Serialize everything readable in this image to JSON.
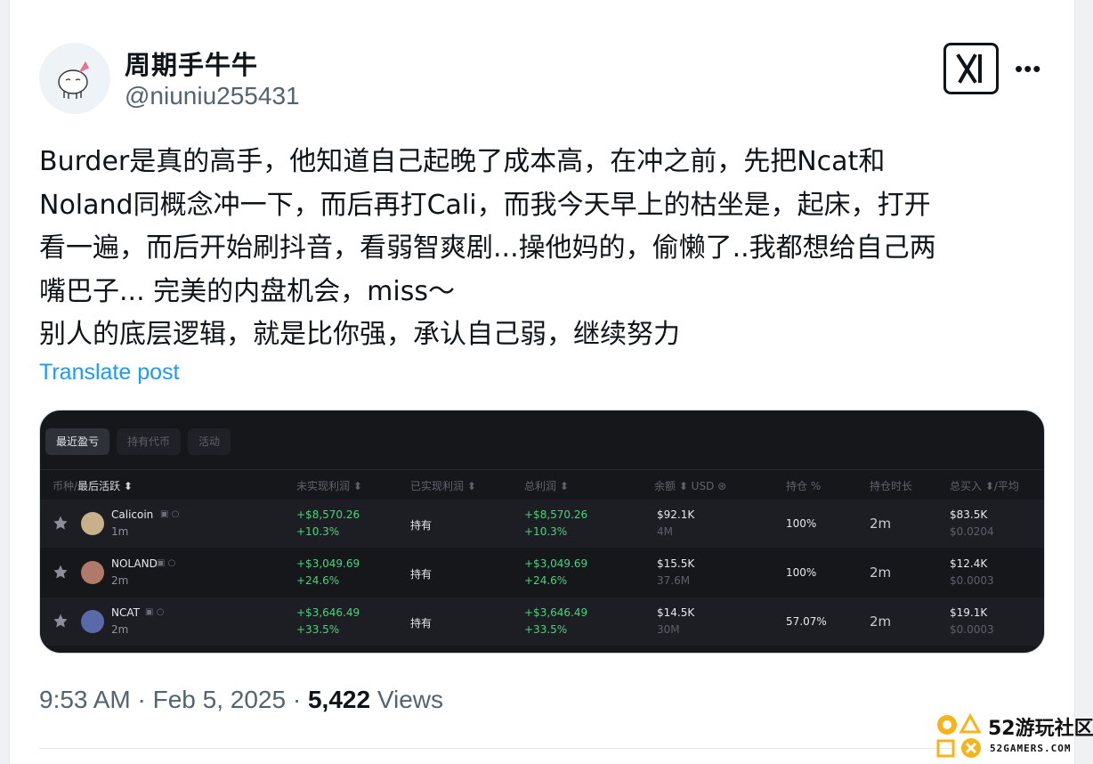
{
  "post": {
    "display_name": "周期手牛牛",
    "handle": "@niuniu255431",
    "text_lines": [
      "Burder是真的高手，他知道自己起晚了成本高，在冲之前，先把Ncat和",
      "Noland同概念冲一下，而后再打Cali，而我今天早上的枯坐是，起床，打开",
      "看一遍，而后开始刷抖音，看弱智爽剧...操他妈的，偷懒了..我都想给自己两",
      "嘴巴子... 完美的内盘机会，miss～",
      "别人的底层逻辑，就是比你强，承认自己弱，继续努力"
    ],
    "translate_label": "Translate post",
    "time": "9:53 AM",
    "sep1": " · ",
    "date": "Feb 5, 2025",
    "sep2": " · ",
    "views_count": "5,422",
    "views_label": " Views"
  },
  "icons": {
    "more": "more-horizontal-icon",
    "x_logo": "x-grok-logo-icon",
    "star": "star-icon"
  },
  "embed": {
    "tabs": [
      "最近盈亏",
      "持有代币",
      "活动"
    ],
    "headers": {
      "coin": "币种/",
      "coin_active": "最后活跃 ⬍",
      "unrealized": "未实现利润 ⬍",
      "realized": "已实现利润 ⬍",
      "total": "总利润 ⬍",
      "balance": "余额 ⬍  USD ⊛",
      "position": "持仓 %",
      "duration": "持仓时长",
      "buy": "总买入 ⬍/平均"
    },
    "rows": [
      {
        "name": "Calicoin",
        "time": "1m",
        "unrealized": "+$8,570.26",
        "unrealized_pct": "+10.3%",
        "realized": "持有",
        "total": "+$8,570.26",
        "total_pct": "+10.3%",
        "balance": "$92.1K",
        "balance_sub": "4M",
        "position": "100%",
        "duration": "2m",
        "buy": "$83.5K",
        "buy_avg": "$0.0204",
        "icon_color": "#c8b08a"
      },
      {
        "name": "NOLAND",
        "time": "2m",
        "unrealized": "+$3,049.69",
        "unrealized_pct": "+24.6%",
        "realized": "持有",
        "total": "+$3,049.69",
        "total_pct": "+24.6%",
        "balance": "$15.5K",
        "balance_sub": "37.6M",
        "position": "100%",
        "duration": "2m",
        "buy": "$12.4K",
        "buy_avg": "$0.0003",
        "icon_color": "#b07a6a"
      },
      {
        "name": "NCAT",
        "time": "2m",
        "unrealized": "+$3,646.49",
        "unrealized_pct": "+33.5%",
        "realized": "持有",
        "total": "+$3,646.49",
        "total_pct": "+33.5%",
        "balance": "$14.5K",
        "balance_sub": "30M",
        "position": "57.07%",
        "duration": "2m",
        "buy": "$19.1K",
        "buy_avg": "$0.0003",
        "icon_color": "#5a6aa8"
      }
    ]
  },
  "watermark": {
    "title": "52游玩社区",
    "sub": "52GAMERS.COM"
  },
  "colors": {
    "link": "#1d9bf0",
    "profit": "#4fd07c",
    "embed_bg": "#16171b"
  }
}
